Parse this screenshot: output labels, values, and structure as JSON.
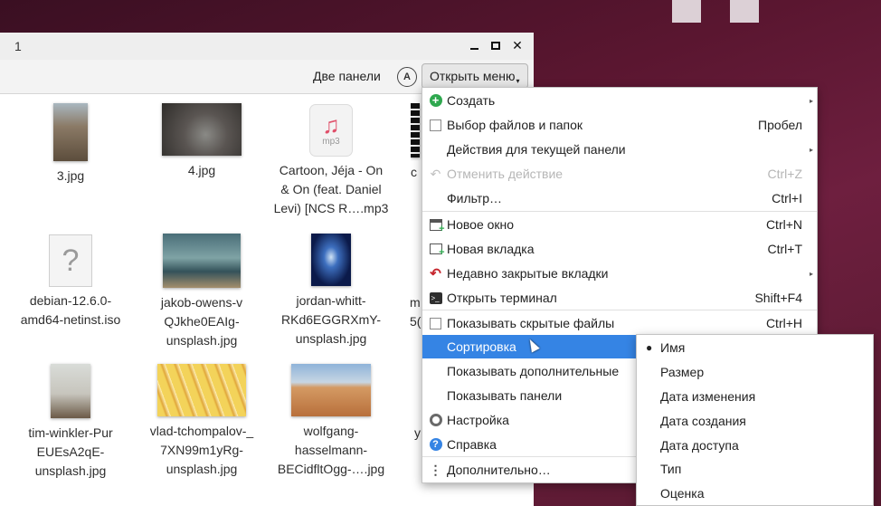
{
  "window": {
    "title": "1",
    "controls": {
      "minimize_icon": "minimize-icon",
      "maximize_icon": "maximize-icon",
      "close_icon": "close-icon",
      "close_glyph": "✕"
    }
  },
  "toolbar": {
    "two_panels_label": "Две панели",
    "search_icon": "search-icon",
    "search_glyph": "A",
    "open_menu_label": "Открыть меню",
    "open_menu_arrow": "▾"
  },
  "files": [
    {
      "name_lines": [
        "3.jpg"
      ],
      "icon": "image-thumbnail"
    },
    {
      "name_lines": [
        "4.jpg"
      ],
      "icon": "image-thumbnail"
    },
    {
      "name_lines": [
        "Cartoon, Jéja - On",
        "& On (feat. Daniel",
        "Levi) [NCS R….mp3"
      ],
      "icon": "audio-file-icon",
      "icon_ext": "mp3",
      "note_glyph": "♫"
    },
    {
      "name_lines": [
        "c"
      ],
      "icon": "video-thumbnail"
    },
    {
      "name_lines": [
        "debian-12.6.0-",
        "amd64-netinst.iso"
      ],
      "icon": "unknown-file-icon",
      "icon_glyph": "?"
    },
    {
      "name_lines": [
        "jakob-owens-v",
        "QJkhe0EAIg-",
        "unsplash.jpg"
      ],
      "icon": "image-thumbnail"
    },
    {
      "name_lines": [
        "jordan-whitt-",
        "RKd6EGGRXmY-",
        "unsplash.jpg"
      ],
      "icon": "image-thumbnail"
    },
    {
      "name_lines": [
        "m",
        "5("
      ],
      "icon": "image-thumbnail"
    },
    {
      "name_lines": [
        "tim-winkler-Pur",
        "EUEsA2qE-",
        "unsplash.jpg"
      ],
      "icon": "image-thumbnail"
    },
    {
      "name_lines": [
        "vlad-tchompalov-_",
        "7XN99m1yRg-",
        "unsplash.jpg"
      ],
      "icon": "image-thumbnail"
    },
    {
      "name_lines": [
        "wolfgang-",
        "hasselmann-",
        "BECidfltOgg-….jpg"
      ],
      "icon": "image-thumbnail"
    },
    {
      "name_lines": [
        "y"
      ],
      "icon": "image-thumbnail"
    }
  ],
  "main_menu": {
    "items": [
      {
        "label": "Создать",
        "icon": "plus-icon",
        "glyph": "+",
        "submenu": true
      },
      {
        "label": "Выбор файлов и папок",
        "icon": "checkbox-icon",
        "shortcut": "Пробел"
      },
      {
        "label": "Действия для текущей панели",
        "submenu": true
      },
      {
        "label": "Отменить действие",
        "icon": "undo-icon",
        "glyph": "↶",
        "shortcut": "Ctrl+Z",
        "disabled": true
      },
      {
        "label": "Фильтр…",
        "shortcut": "Ctrl+I"
      },
      {
        "label": "Новое окно",
        "icon": "new-window-icon",
        "shortcut": "Ctrl+N"
      },
      {
        "label": "Новая вкладка",
        "icon": "new-tab-icon",
        "shortcut": "Ctrl+T"
      },
      {
        "label": "Недавно закрытые вкладки",
        "icon": "recent-tabs-icon",
        "glyph": "↶",
        "submenu": true
      },
      {
        "label": "Открыть терминал",
        "icon": "terminal-icon",
        "glyph": ">_",
        "shortcut": "Shift+F4"
      },
      {
        "label": "Показывать скрытые файлы",
        "icon": "checkbox-icon",
        "shortcut": "Ctrl+H"
      },
      {
        "label": "Сортировка",
        "submenu": true,
        "active": true
      },
      {
        "label": "Показывать дополнительные"
      },
      {
        "label": "Показывать панели"
      },
      {
        "label": "Настройка",
        "icon": "gear-icon"
      },
      {
        "label": "Справка",
        "icon": "help-icon",
        "glyph": "?"
      },
      {
        "label": "Дополнительно…",
        "icon": "more-icon",
        "glyph": "⋮"
      }
    ],
    "submenu_arrow": "▸"
  },
  "sort_menu": {
    "items": [
      {
        "label": "Имя",
        "selected": true
      },
      {
        "label": "Размер"
      },
      {
        "label": "Дата изменения"
      },
      {
        "label": "Дата создания"
      },
      {
        "label": "Дата доступа"
      },
      {
        "label": "Тип"
      },
      {
        "label": "Оценка"
      }
    ],
    "bullet": "●"
  },
  "colors": {
    "accent": "#3584e4",
    "desktop": "#5a1630",
    "create_icon": "#2fa84f",
    "recent_icon": "#c6262e"
  }
}
